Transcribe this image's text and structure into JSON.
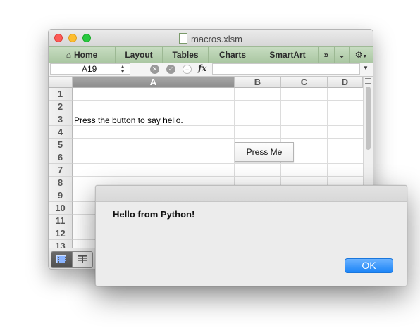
{
  "window": {
    "title": "macros.xlsm"
  },
  "ribbon": {
    "tabs": [
      "Home",
      "Layout",
      "Tables",
      "Charts",
      "SmartArt"
    ],
    "overflow_label": "»",
    "collapse_label": "⌄",
    "settings_label": "⚙"
  },
  "formula_bar": {
    "cell_ref": "A19",
    "fx_label": "fx",
    "value": ""
  },
  "sheet": {
    "columns": [
      "A",
      "B",
      "C",
      "D"
    ],
    "selected_column": "A",
    "rows": [
      "1",
      "2",
      "3",
      "4",
      "5",
      "6",
      "7",
      "8",
      "9",
      "10",
      "11",
      "12",
      "13"
    ],
    "cells": {
      "A3": "Press the button to say hello."
    },
    "button_label": "Press Me"
  },
  "dialog": {
    "message": "Hello from Python!",
    "ok_label": "OK"
  },
  "colors": {
    "ribbon_accent": "#b4d0ac",
    "ok_blue": "#1b84f7",
    "selected_header": "#8d8d8d"
  }
}
